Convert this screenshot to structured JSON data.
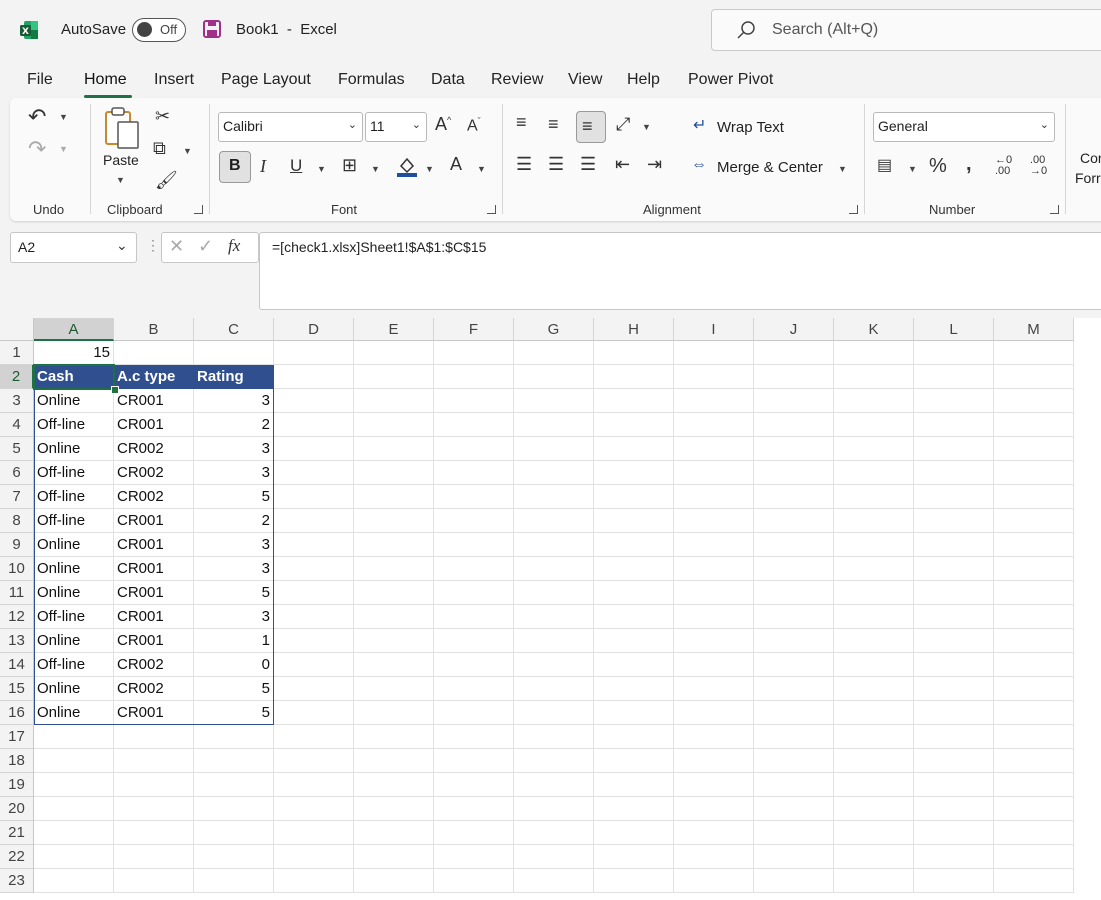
{
  "title_bar": {
    "autosave_label": "AutoSave",
    "autosave_state": "Off",
    "doc_title": "Book1  -  Excel",
    "search_placeholder": "Search (Alt+Q)"
  },
  "menu": [
    "File",
    "Home",
    "Insert",
    "Page Layout",
    "Formulas",
    "Data",
    "Review",
    "View",
    "Help",
    "Power Pivot"
  ],
  "menu_active": "Home",
  "ribbon": {
    "groups": {
      "undo": "Undo",
      "clipboard": "Clipboard",
      "font": "Font",
      "alignment": "Alignment",
      "number": "Number"
    },
    "paste_label": "Paste",
    "font_name": "Calibri",
    "font_size": "11",
    "wrap_text": "Wrap Text",
    "merge_center": "Merge & Center",
    "number_format": "General",
    "cut_off_label_1": "Cor",
    "cut_off_label_2": "Forr"
  },
  "formula_bar": {
    "name_box": "A2",
    "formula": "=[check1.xlsx]Sheet1!$A$1:$C$15"
  },
  "sheet": {
    "columns": [
      "A",
      "B",
      "C",
      "D",
      "E",
      "F",
      "G",
      "H",
      "I",
      "J",
      "K",
      "L",
      "M"
    ],
    "rows": [
      1,
      2,
      3,
      4,
      5,
      6,
      7,
      8,
      9,
      10,
      11,
      12,
      13,
      14,
      15,
      16,
      17,
      18,
      19,
      20,
      21,
      22,
      23
    ],
    "a1_value": "15",
    "headers": [
      "Cash",
      "A.c type",
      "Rating"
    ],
    "data": [
      [
        "Online",
        "CR001",
        "3"
      ],
      [
        "Off-line",
        "CR001",
        "2"
      ],
      [
        "Online",
        "CR002",
        "3"
      ],
      [
        "Off-line",
        "CR002",
        "3"
      ],
      [
        "Off-line",
        "CR002",
        "5"
      ],
      [
        "Off-line",
        "CR001",
        "2"
      ],
      [
        "Online",
        "CR001",
        "3"
      ],
      [
        "Online",
        "CR001",
        "3"
      ],
      [
        "Online",
        "CR001",
        "5"
      ],
      [
        "Off-line",
        "CR001",
        "3"
      ],
      [
        "Online",
        "CR001",
        "1"
      ],
      [
        "Off-line",
        "CR002",
        "0"
      ],
      [
        "Online",
        "CR002",
        "5"
      ],
      [
        "Online",
        "CR001",
        "5"
      ]
    ]
  },
  "colors": {
    "accent": "#1e7145",
    "table_header_bg": "#2f4f8f"
  }
}
